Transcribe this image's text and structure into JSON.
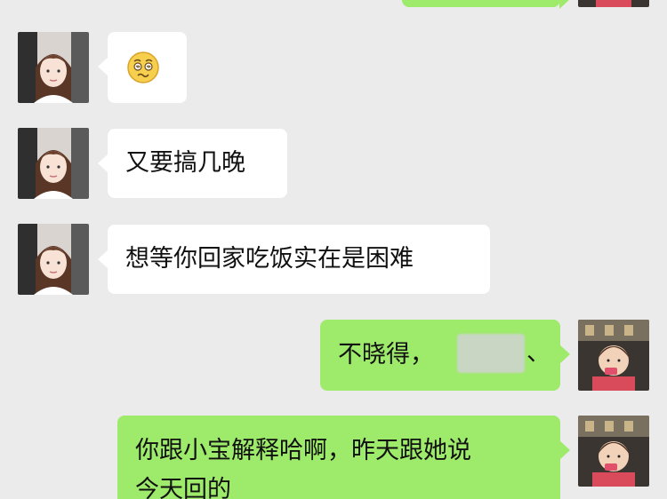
{
  "colors": {
    "background": "#ebebeb",
    "incoming_bubble": "#ffffff",
    "outgoing_bubble": "#9eea6a"
  },
  "messages": [
    {
      "direction": "outgoing",
      "type": "text",
      "text": ""
    },
    {
      "direction": "incoming",
      "type": "sticker",
      "icon": "dizzy-face-emoji-icon"
    },
    {
      "direction": "incoming",
      "type": "text",
      "text": "又要搞几晚"
    },
    {
      "direction": "incoming",
      "type": "text",
      "text": "想等你回家吃饭实在是困难"
    },
    {
      "direction": "outgoing",
      "type": "text",
      "text": "不晓得，",
      "trailing_text": "、"
    },
    {
      "direction": "outgoing",
      "type": "text",
      "text": "你跟小宝解释哈啊，昨天跟她说\n今天回的"
    }
  ]
}
